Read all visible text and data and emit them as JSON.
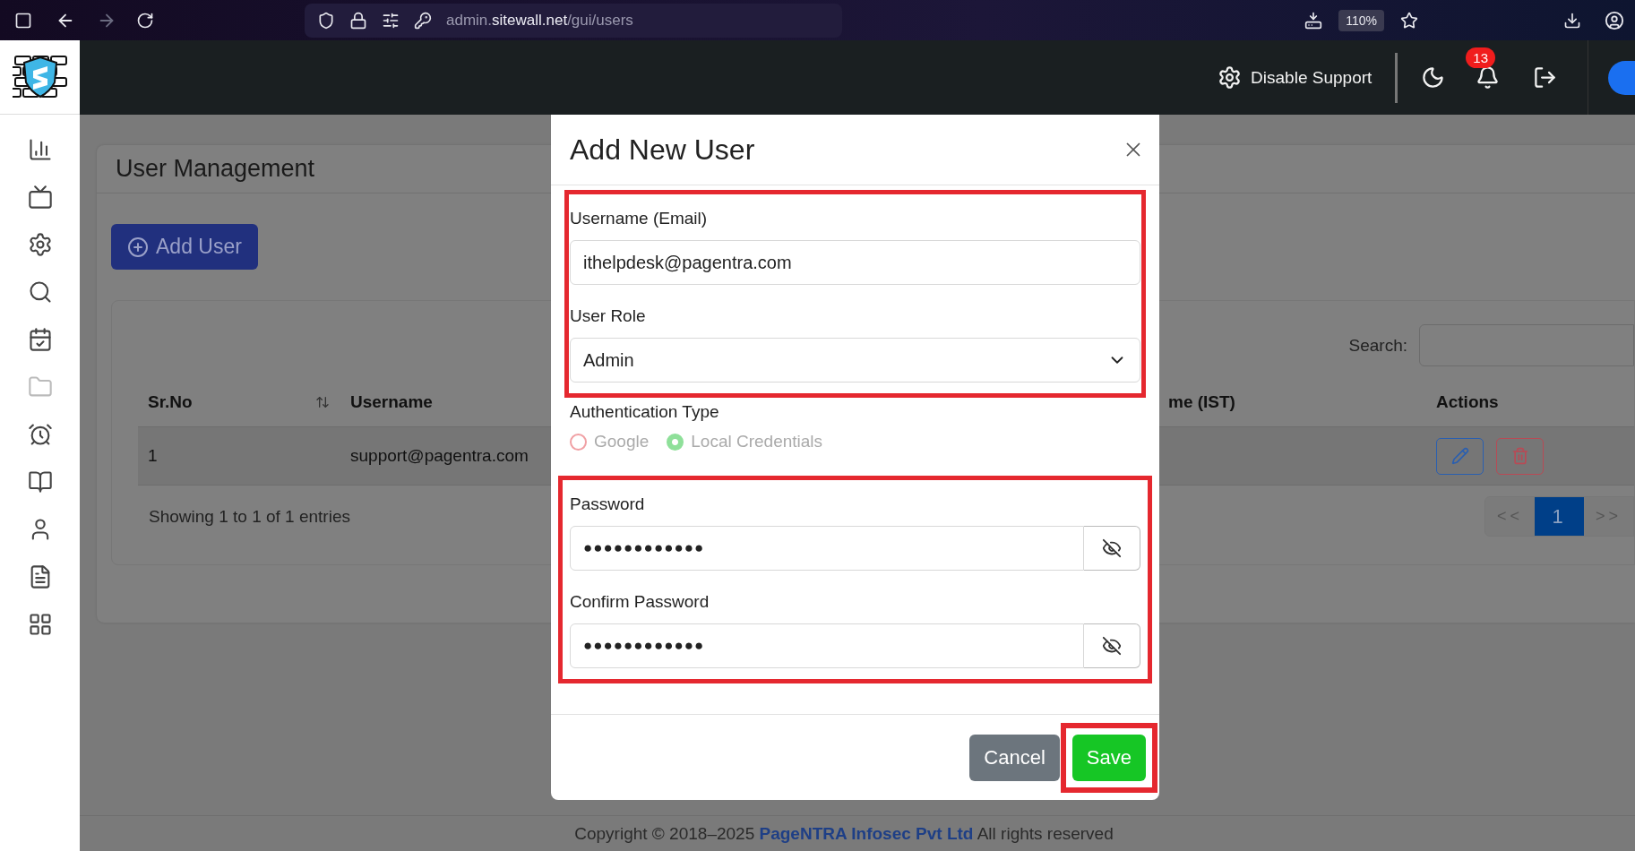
{
  "browser": {
    "url_prefix": "admin.",
    "url_domain": "sitewall.net",
    "url_path": "/gui/users",
    "zoom": "110%"
  },
  "header": {
    "support_button": "Disable Support",
    "notification_count": "13"
  },
  "page": {
    "title": "User Management",
    "add_button": "Add User",
    "search_label": "Search:",
    "table": {
      "columns": [
        "Sr.No",
        "Username",
        "me (IST)",
        "Actions"
      ],
      "rows": [
        {
          "sr_no": "1",
          "username": "support@pagentra.com"
        }
      ]
    },
    "entries_info": "Showing 1 to 1 of 1 entries",
    "pagination": [
      {
        "label": "<<",
        "selected": false
      },
      {
        "label": "1",
        "selected": true
      },
      {
        "label": ">>",
        "selected": false
      }
    ]
  },
  "dialog": {
    "title": "Add New User",
    "groups": [
      {
        "highlighted": true,
        "fields": [
          {
            "kind": "text",
            "label": "Username (Email)",
            "value": "ithelpdesk@pagentra.com"
          },
          {
            "kind": "select",
            "label": "User Role",
            "value": "Admin"
          }
        ]
      },
      {
        "highlighted": false,
        "fields": [
          {
            "kind": "radio",
            "label": "Authentication Type",
            "disabled": true,
            "options": [
              {
                "label": "Google",
                "selected": false
              },
              {
                "label": "Local Credentials",
                "selected": true
              }
            ]
          }
        ]
      },
      {
        "highlighted": true,
        "fields": [
          {
            "kind": "password",
            "label": "Password",
            "value": "●●●●●●●●●●●●"
          },
          {
            "kind": "password",
            "label": "Confirm Password",
            "value": "●●●●●●●●●●●●"
          }
        ]
      }
    ],
    "buttons": [
      {
        "kind": "secondary",
        "label": "Cancel",
        "highlighted": false
      },
      {
        "kind": "primary",
        "label": "Save",
        "highlighted": true
      }
    ]
  },
  "footer": {
    "copyright": "Copyright © 2018–2025",
    "company": "PageNTRA Infosec Pvt Ltd",
    "rights": "All rights reserved"
  }
}
